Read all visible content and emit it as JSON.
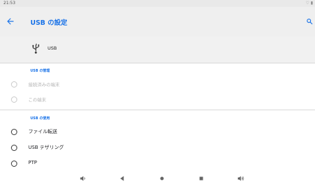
{
  "status_bar": {
    "time": "21:53",
    "icons": "♡ ▮"
  },
  "app_bar": {
    "title": "USB の設定",
    "back_icon": "arrow-back-icon",
    "search_icon": "search-icon"
  },
  "header": {
    "icon": "usb-icon",
    "label": "USB"
  },
  "sections": [
    {
      "title": "USB の管理",
      "items": [
        {
          "label": "接続済みの端末",
          "enabled": false
        },
        {
          "label": "この端末",
          "enabled": false
        }
      ]
    },
    {
      "title": "USB の使用",
      "items": [
        {
          "label": "ファイル転送",
          "enabled": true
        },
        {
          "label": "USB テザリング",
          "enabled": true
        },
        {
          "label": "PTP",
          "enabled": true
        }
      ]
    }
  ],
  "nav_bar": [
    "volume-down-icon",
    "back-triangle-icon",
    "home-icon",
    "recents-icon",
    "volume-up-icon"
  ],
  "colors": {
    "accent": "#1a73e8",
    "app_bar_bg": "#efefef"
  }
}
